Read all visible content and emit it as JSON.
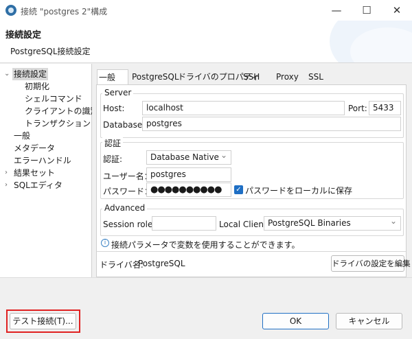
{
  "window": {
    "title": "接続 \"postgres 2\"構成",
    "minimize_icon": "minimize-icon",
    "maximize_icon": "maximize-icon",
    "close_icon": "close-icon"
  },
  "header": {
    "title": "接続設定",
    "subtitle": "PostgreSQL接続設定"
  },
  "tree": {
    "items": [
      {
        "label": "接続設定"
      },
      {
        "label": "初期化"
      },
      {
        "label": "シェルコマンド"
      },
      {
        "label": "クライアントの識別"
      },
      {
        "label": "トランザクション"
      },
      {
        "label": "一般"
      },
      {
        "label": "メタデータ"
      },
      {
        "label": "エラーハンドル"
      },
      {
        "label": "結果セット"
      },
      {
        "label": "SQLエディタ"
      }
    ]
  },
  "tabs": [
    {
      "label": "一般"
    },
    {
      "label": "PostgreSQL"
    },
    {
      "label": "ドライバのプロパティ"
    },
    {
      "label": "SSH"
    },
    {
      "label": "Proxy"
    },
    {
      "label": "SSL"
    }
  ],
  "server": {
    "group_label": "Server",
    "host_label": "Host:",
    "host_value": "localhost",
    "port_label": "Port:",
    "port_value": "5433",
    "database_label": "Database:",
    "database_value": "postgres"
  },
  "auth": {
    "group_label": "認証",
    "auth_label": "認証:",
    "auth_value": "Database Native",
    "user_label": "ユーザー名：",
    "user_value": "postgres",
    "password_label": "パスワード：",
    "password_value": "●●●●●●●●●●",
    "save_password_label": "パスワードをローカルに保存",
    "save_password_checked": true
  },
  "advanced": {
    "group_label": "Advanced",
    "session_role_label": "Session role:",
    "session_role_value": "",
    "local_client_label": "Local Client:",
    "local_client_value": "PostgreSQL Binaries"
  },
  "info": {
    "text": "接続パラメータで変数を使用することができます。"
  },
  "driver": {
    "label": "ドライバ名:",
    "name": "PostgreSQL",
    "edit_button": "ドライバの設定を編集"
  },
  "footer": {
    "test_button": "テスト接続(T)...",
    "ok_button": "OK",
    "cancel_button": "キャンセル"
  },
  "colors": {
    "accent": "#1f6fc4",
    "highlight_outline": "#e02020"
  }
}
